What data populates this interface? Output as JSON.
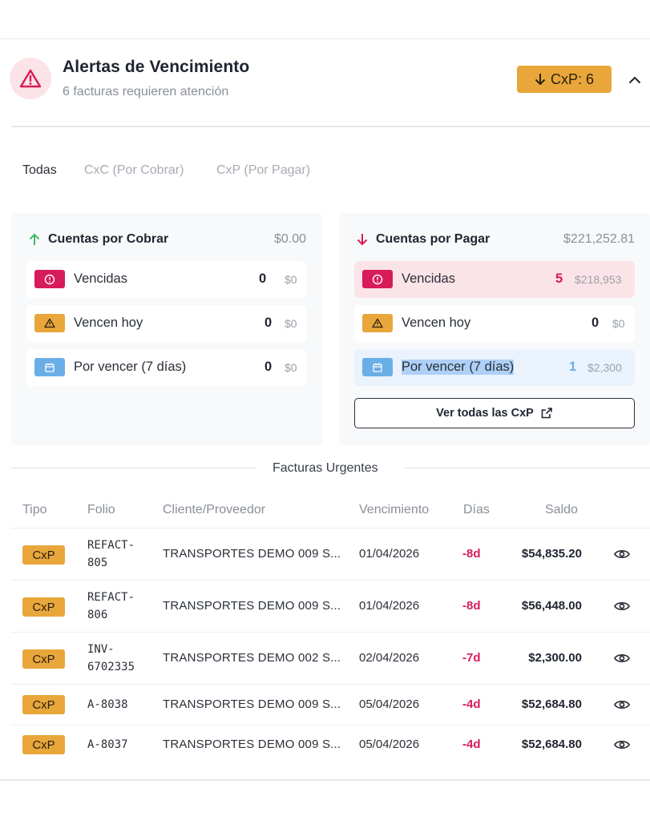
{
  "header": {
    "title": "Alertas de Vencimiento",
    "subtitle": "6 facturas requieren atención",
    "badge_label": "CxP: 6",
    "alert_icon": "warning-triangle-icon",
    "collapse_icon": "chevron-up-icon"
  },
  "tabs": [
    {
      "label": "Todas",
      "active": true
    },
    {
      "label": "CxC (Por Cobrar)",
      "active": false
    },
    {
      "label": "CxP (Por Pagar)",
      "active": false
    }
  ],
  "cobrar": {
    "title": "Cuentas por Cobrar",
    "total": "$0.00",
    "rows": [
      {
        "label": "Vencidas",
        "count": "0",
        "amount": "$0"
      },
      {
        "label": "Vencen hoy",
        "count": "0",
        "amount": "$0"
      },
      {
        "label": "Por vencer (7 días)",
        "count": "0",
        "amount": "$0"
      }
    ]
  },
  "pagar": {
    "title": "Cuentas por Pagar",
    "total": "$221,252.81",
    "rows": [
      {
        "label": "Vencidas",
        "count": "5",
        "amount": "$218,953"
      },
      {
        "label": "Vencen hoy",
        "count": "0",
        "amount": "$0"
      },
      {
        "label": "Por vencer (7 días)",
        "count": "1",
        "amount": "$2,300"
      }
    ],
    "view_all_label": "Ver todas las CxP"
  },
  "urgent": {
    "title": "Facturas Urgentes",
    "columns": [
      "Tipo",
      "Folio",
      "Cliente/Proveedor",
      "Vencimiento",
      "Días",
      "Saldo"
    ],
    "rows": [
      {
        "tipo": "CxP",
        "folio": "REFACT-\n805",
        "cliente": "TRANSPORTES DEMO 009 S...",
        "vencimiento": "01/04/2026",
        "dias": "-8d",
        "saldo": "$54,835.20"
      },
      {
        "tipo": "CxP",
        "folio": "REFACT-\n806",
        "cliente": "TRANSPORTES DEMO 009 S...",
        "vencimiento": "01/04/2026",
        "dias": "-8d",
        "saldo": "$56,448.00"
      },
      {
        "tipo": "CxP",
        "folio": "INV-\n6702335",
        "cliente": "TRANSPORTES DEMO 002 S...",
        "vencimiento": "02/04/2026",
        "dias": "-7d",
        "saldo": "$2,300.00"
      },
      {
        "tipo": "CxP",
        "folio": "A-8038",
        "cliente": "TRANSPORTES DEMO 009 S...",
        "vencimiento": "05/04/2026",
        "dias": "-4d",
        "saldo": "$52,684.80"
      },
      {
        "tipo": "CxP",
        "folio": "A-8037",
        "cliente": "TRANSPORTES DEMO 009 S...",
        "vencimiento": "05/04/2026",
        "dias": "-4d",
        "saldo": "$52,684.80"
      }
    ]
  },
  "colors": {
    "danger": "#d81b5a",
    "warning": "#e9a63a",
    "info": "#6aaee8",
    "positive": "#3fb96a"
  }
}
